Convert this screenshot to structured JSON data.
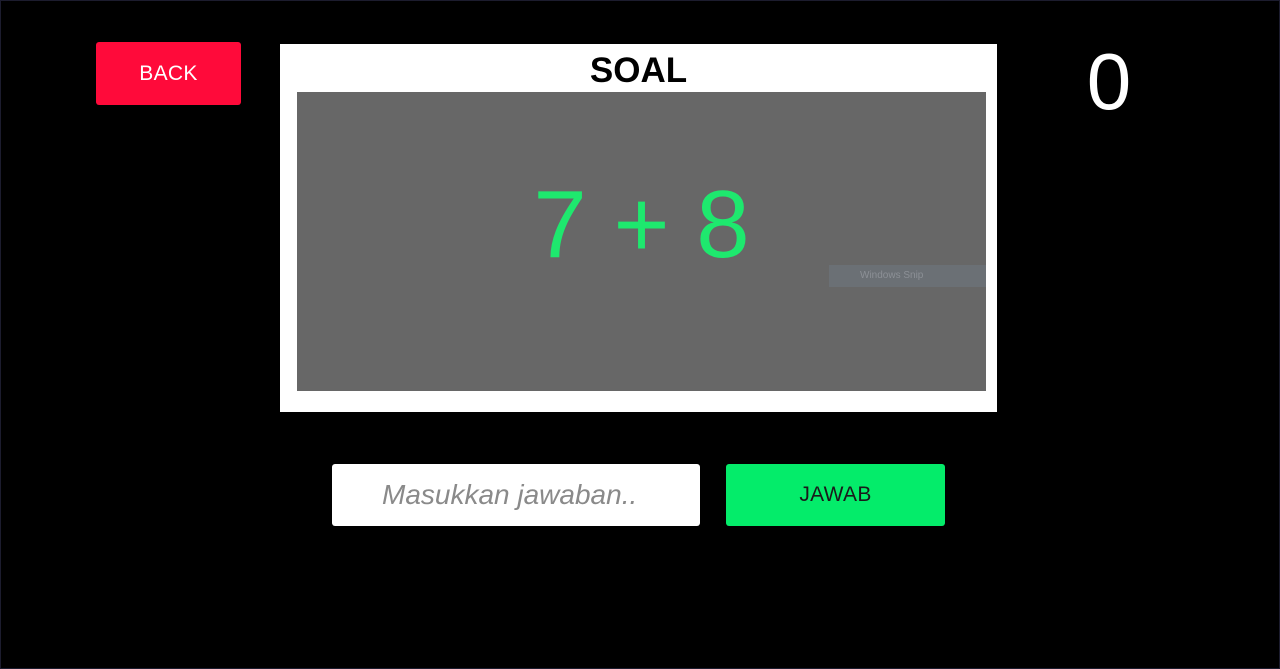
{
  "header": {
    "back_label": "BACK",
    "score": "0"
  },
  "question_panel": {
    "title": "SOAL",
    "question": "7 + 8",
    "question_color": "#1ee86e"
  },
  "overlay": {
    "label": "Windows Snip"
  },
  "answer": {
    "placeholder": "Masukkan jawaban..",
    "value": "",
    "submit_label": "JAWAB"
  },
  "colors": {
    "background": "#000000",
    "back_button": "#ff0a3a",
    "submit_button": "#04ec6a",
    "question_box": "#676767"
  }
}
